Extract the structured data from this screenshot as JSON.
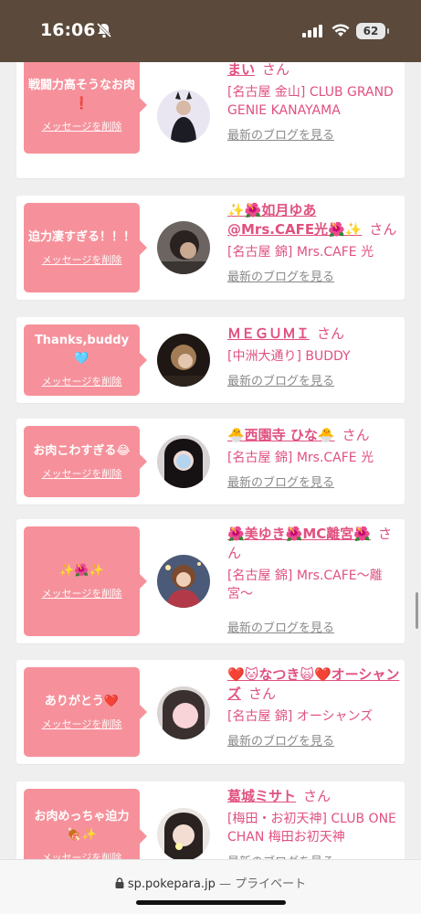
{
  "status": {
    "time": "16:06",
    "battery": "62"
  },
  "cards": [
    {
      "message": "戦闘力高そうなお肉❗",
      "delete": "メッセージを削除",
      "name": "まい",
      "san": "さん",
      "shop": "[名古屋 金山] CLUB GRAND GENIE KANAYAMA",
      "blog": "最新のブログを見る"
    },
    {
      "message": "迫力凄すぎる！！！",
      "delete": "メッセージを削除",
      "name": "✨🌺如月ゆあ @Mrs.CAFE光🌺✨",
      "san": "さん",
      "shop": "[名古屋 錦] Mrs.CAFE 光",
      "blog": "最新のブログを見る"
    },
    {
      "message": "Thanks,buddy🩵",
      "delete": "メッセージを削除",
      "name": "ＭＥＧＵＭＩ",
      "san": "さん",
      "shop": "[中洲大通り] BUDDY",
      "blog": "最新のブログを見る"
    },
    {
      "message": "お肉こわすぎる😂",
      "delete": "メッセージを削除",
      "name": "🐣西園寺 ひな🐣",
      "san": "さん",
      "shop": "[名古屋 錦] Mrs.CAFE 光",
      "blog": "最新のブログを見る"
    },
    {
      "message": "✨🌺✨",
      "delete": "メッセージを削除",
      "name": "🌺美ゆき🌺MC離宮🌺",
      "san": "さん",
      "shop": "[名古屋 錦] Mrs.CAFE〜離宮〜",
      "blog": "最新のブログを見る"
    },
    {
      "message": "ありがとう❤️",
      "delete": "メッセージを削除",
      "name": "❤️🐱なつき🙀❤️オーシャンズ",
      "san": "さん",
      "shop": "[名古屋 錦] オーシャンズ",
      "blog": "最新のブログを見る"
    },
    {
      "message": "お肉めっちゃ迫力🍖✨",
      "delete": "メッセージを削除",
      "name": "葛城ミサト",
      "san": "さん",
      "shop": "[梅田・お初天神] CLUB ONE CHAN 梅田お初天神",
      "blog": "最新のブログを見る"
    }
  ],
  "url": {
    "domain": "sp.pokepara.jp",
    "suffix": " — プライベート"
  }
}
